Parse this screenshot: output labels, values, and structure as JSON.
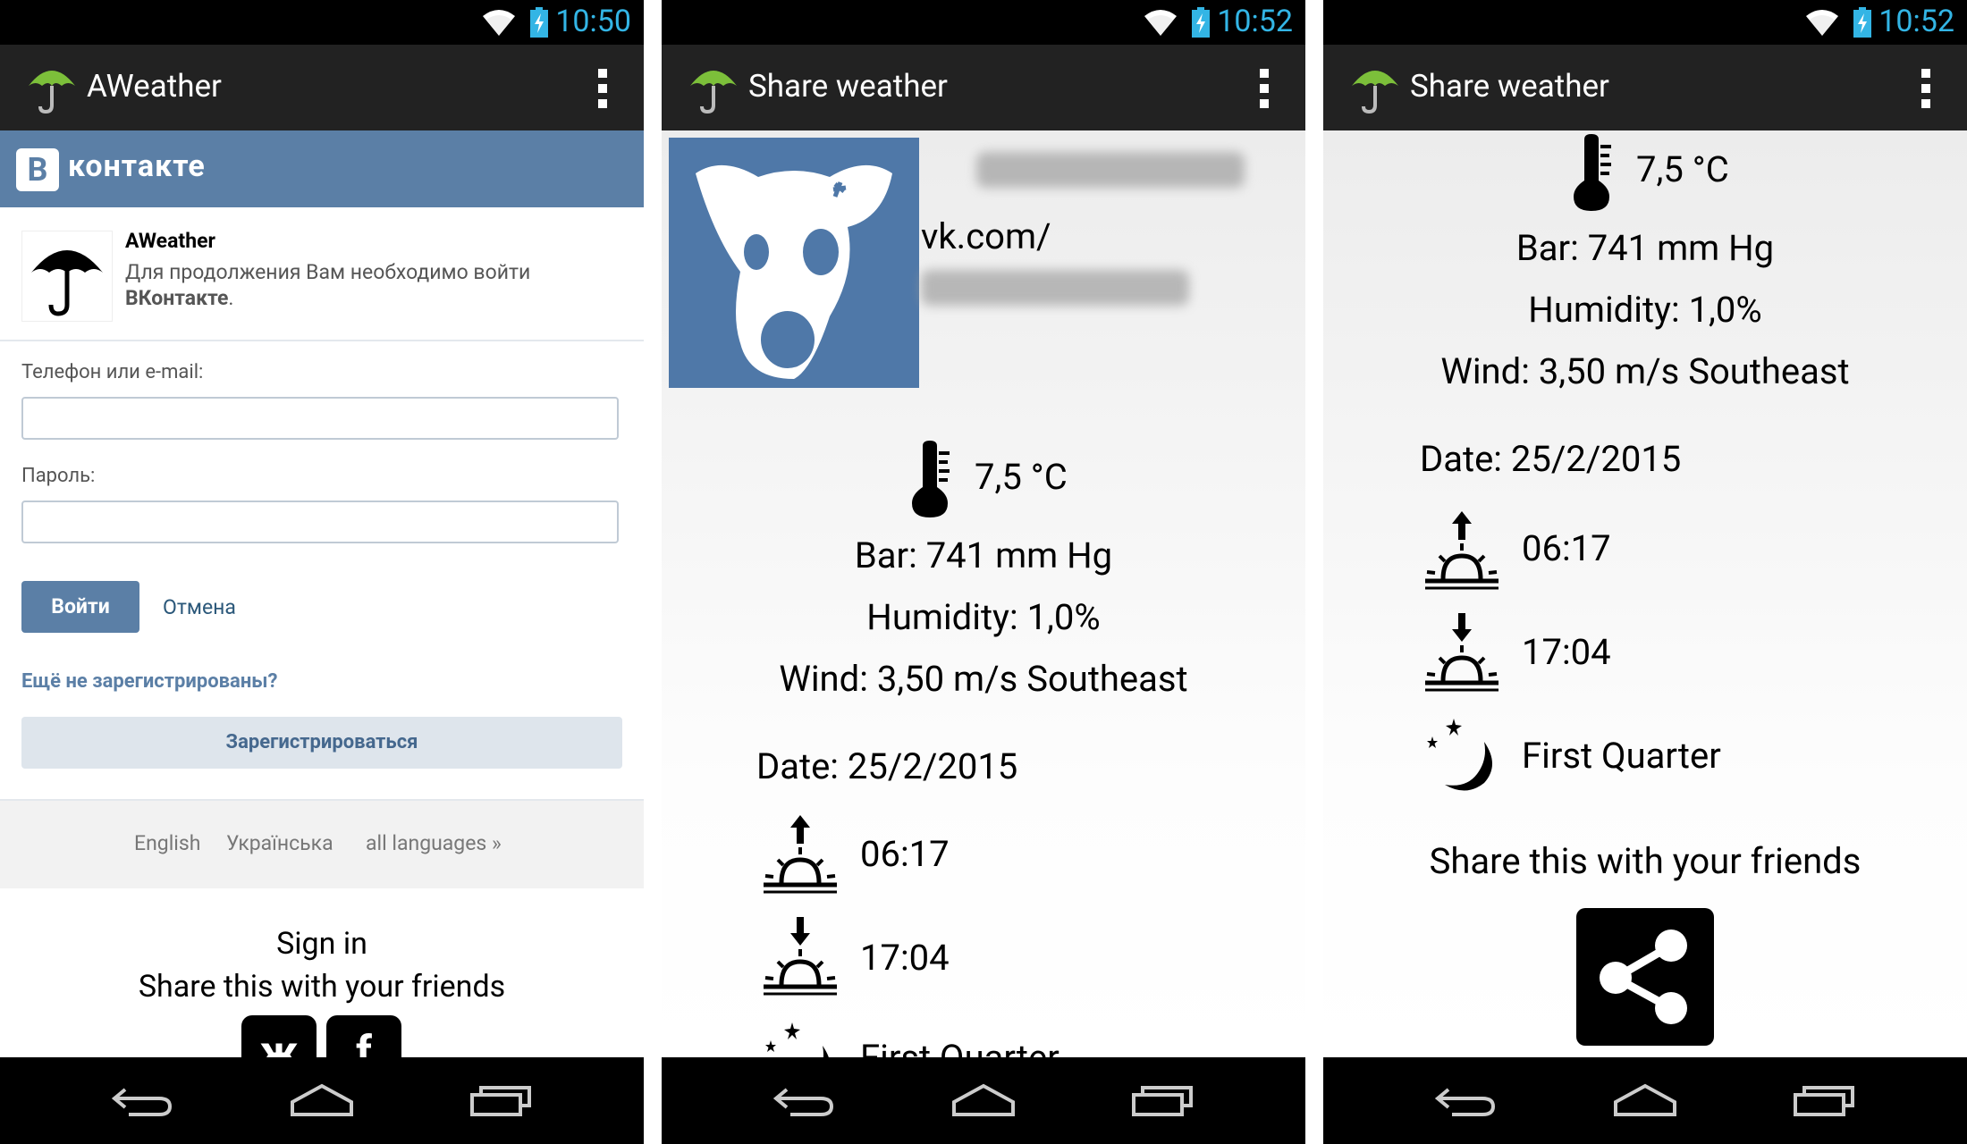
{
  "status": {
    "time_left": "10:50",
    "time_mid": "10:52",
    "time_right": "10:52"
  },
  "panel1": {
    "app_title": "AWeather",
    "vk_brand_b": "B",
    "vk_brand": "контакте",
    "app_name": "AWeather",
    "app_desc_prefix": "Для продолжения Вам необходимо войти",
    "app_desc_link": "ВКонтакте",
    "app_desc_suffix": ".",
    "phone_label": "Телефон или e-mail:",
    "password_label": "Пароль:",
    "login_button": "Войти",
    "cancel_link": "Отмена",
    "not_registered": "Ещё не зарегистрированы?",
    "register_button": "Зарегистрироваться",
    "languages": [
      "English",
      "Українська",
      "all languages »"
    ],
    "sign_in": "Sign in",
    "share_text": "Share this with your friends",
    "social_buttons": [
      "ж",
      "f"
    ]
  },
  "panel2": {
    "title": "Share weather",
    "profile_link": "vk.com/",
    "temperature": "7,5 °C",
    "bar": "Bar: 741 mm Hg",
    "humidity": "Humidity: 1,0%",
    "wind": "Wind: 3,50 m/s Southeast",
    "date": "Date: 25/2/2015",
    "sunrise": "06:17",
    "sunset": "17:04",
    "moon": "First Quarter"
  },
  "panel3": {
    "title": "Share weather",
    "temperature": "7,5 °C",
    "bar": "Bar: 741 mm Hg",
    "humidity": "Humidity: 1,0%",
    "wind": "Wind: 3,50 m/s Southeast",
    "date": "Date: 25/2/2015",
    "sunrise": "06:17",
    "sunset": "17:04",
    "moon": "First Quarter",
    "share_text": "Share this with your friends"
  },
  "colors": {
    "status_text": "#33b5e5",
    "vk_blue": "#5b7fa6",
    "action_bar": "#222222",
    "umbrella_green": "#6aaa2a"
  }
}
